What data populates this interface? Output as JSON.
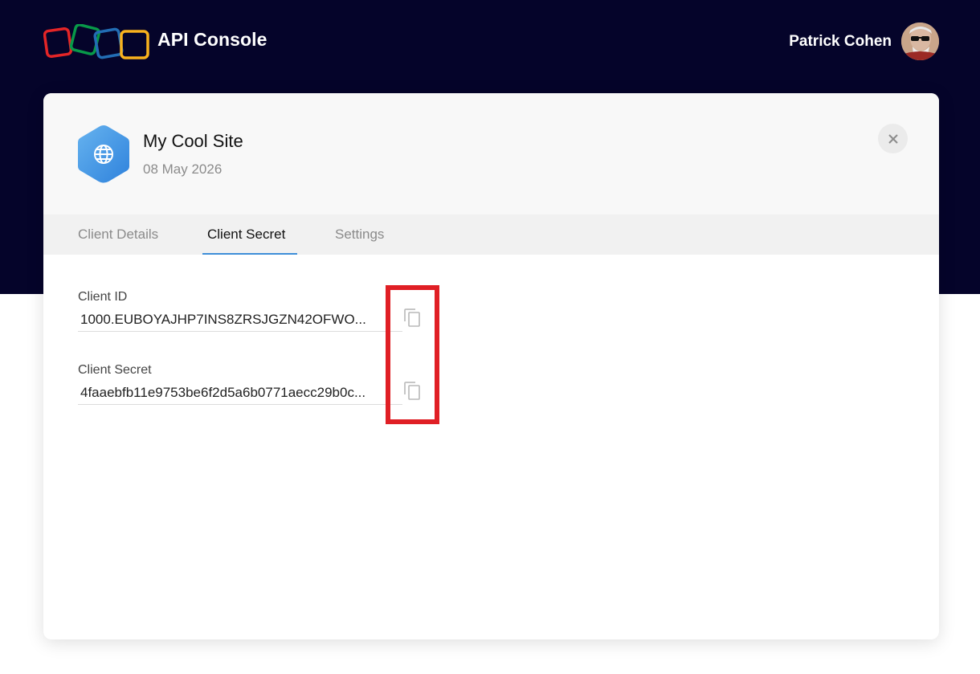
{
  "header": {
    "app_title": "API Console",
    "user_name": "Patrick Cohen",
    "background_color": "#05042a",
    "logo_colors": [
      "#e42527",
      "#089949",
      "#226db4",
      "#f9b21d"
    ]
  },
  "client": {
    "name": "My Cool Site",
    "date": "08 May 2026",
    "icon": "globe-icon"
  },
  "tabs": [
    {
      "label": "Client Details",
      "active": false
    },
    {
      "label": "Client Secret",
      "active": true
    },
    {
      "label": "Settings",
      "active": false
    }
  ],
  "fields": {
    "client_id": {
      "label": "Client ID",
      "value": "1000.EUBOYAJHP7INS8ZRSJGZN42OFWO..."
    },
    "client_secret": {
      "label": "Client Secret",
      "value": "4faaebfb11e9753be6f2d5a6b0771aecc29b0c..."
    }
  },
  "icons": {
    "close": "close-icon",
    "copy": "copy-icon"
  },
  "accent_color": "#3e8ed8",
  "highlight_color": "#e01f25"
}
